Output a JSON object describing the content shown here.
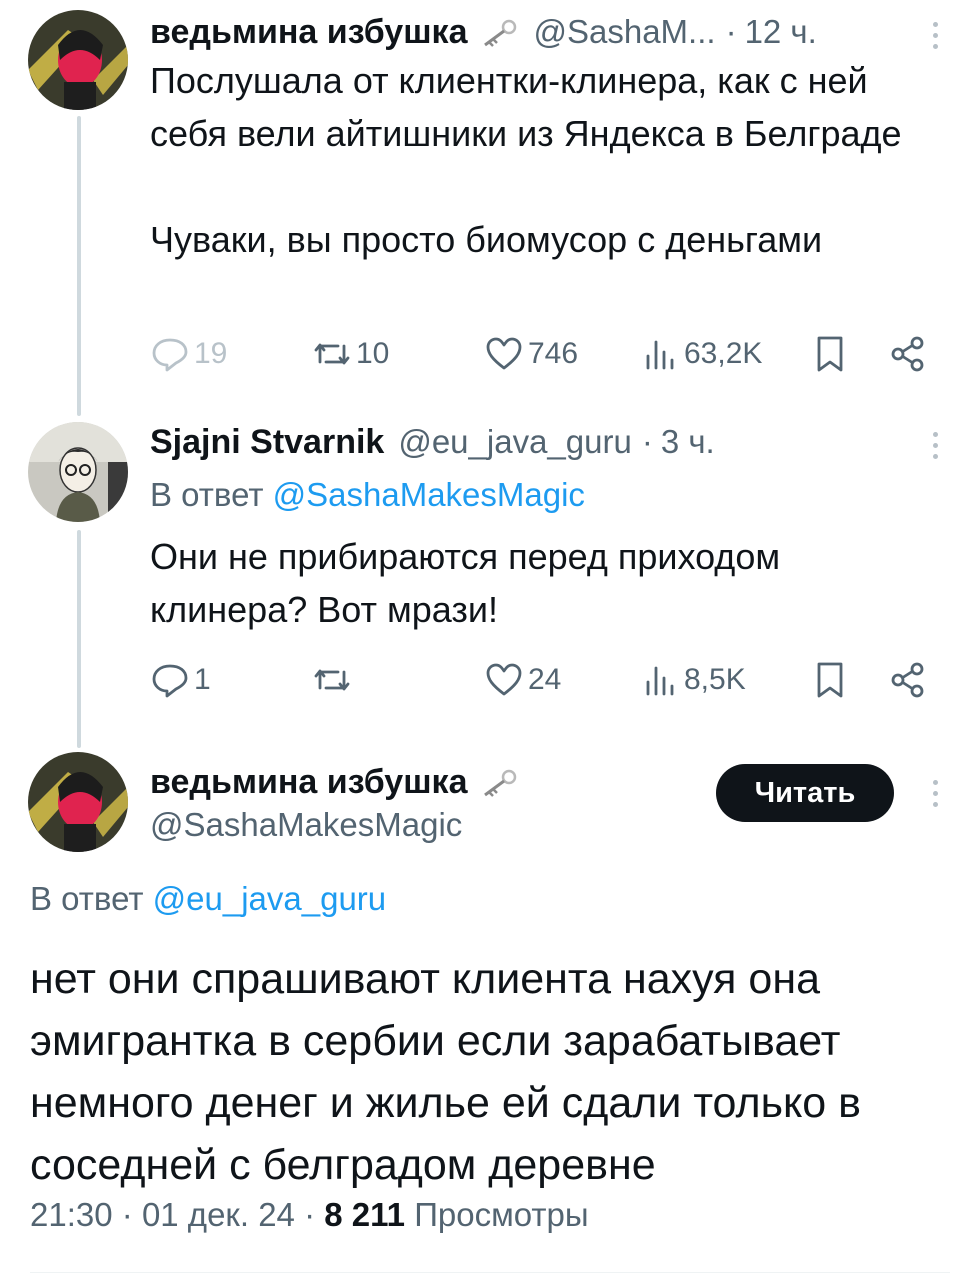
{
  "tweets": [
    {
      "name": "ведьмина избушка",
      "handle": "@SashaM...",
      "time_sep": "·",
      "time": "12 ч.",
      "text": "Послушала от клиентки-клинера, как с ней себя вели айтишники из Яндекса в Белграде\n\nЧуваки, вы просто биомусор с деньгами",
      "stats": {
        "replies": "19",
        "reposts": "10",
        "likes": "746",
        "views": "63,2K"
      }
    },
    {
      "name": "Sjajni Stvarnik",
      "handle": "@eu_java_guru",
      "time_sep": "·",
      "time": "3 ч.",
      "reply_prefix": "В ответ",
      "reply_to": "@SashaMakesMagic",
      "text": "Они не прибираются перед приходом клинера? Вот мрази!",
      "stats": {
        "replies": "1",
        "reposts": "",
        "likes": "24",
        "views": "8,5K"
      }
    }
  ],
  "main_tweet": {
    "name": "ведьмина избушка",
    "handle": "@SashaMakesMagic",
    "follow_label": "Читать",
    "reply_prefix": "В ответ",
    "reply_to": "@eu_java_guru",
    "text": "нет они спрашивают клиента нахуя она эмигрантка в сербии если зарабатывает немного денег и жилье ей сдали только в соседней с белградом деревне",
    "time": "21:30",
    "sep1": "·",
    "date": "01 дек. 24",
    "sep2": "·",
    "views_count": "8 211",
    "views_label": "Просмотры"
  },
  "icons": [
    "key-icon",
    "reply-icon",
    "repost-icon",
    "like-icon",
    "views-icon",
    "bookmark-icon",
    "share-icon",
    "more-icon"
  ],
  "colors": {
    "text": "#0f1419",
    "secondary": "#536471",
    "link": "#1d9bf0",
    "thread_line": "#cfd9de"
  }
}
